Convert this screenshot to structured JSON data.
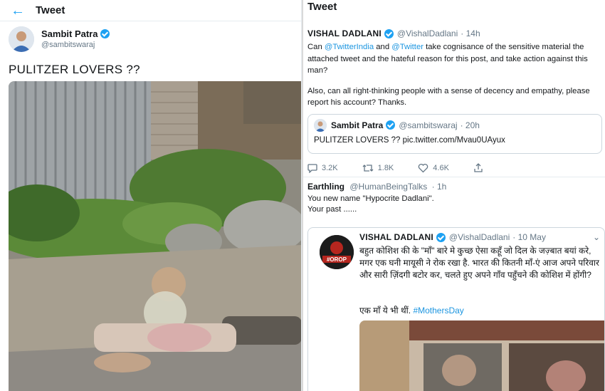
{
  "left": {
    "header": {
      "title": "Tweet"
    },
    "author": {
      "name": "Sambit Patra",
      "handle": "@sambitswaraj"
    },
    "tweet_text": "PULITZER LOVERS ??"
  },
  "right": {
    "header": {
      "title": "Tweet"
    },
    "main_tweet": {
      "name": "VISHAL DADLANI",
      "handle": "@VishalDadlani",
      "time": "· 14h",
      "body_1_pre": "Can ",
      "mention_1": "@TwitterIndia",
      "body_1_mid": " and ",
      "mention_2": "@Twitter",
      "body_1_post": " take cognisance of the sensitive material the attached tweet and the hateful reason for this post, and take action against this man?",
      "body_2": "Also, can all right-thinking people with a sense of decency and empathy, please report his account? Thanks.",
      "quoted": {
        "name": "Sambit Patra",
        "handle": "@sambitswaraj",
        "time": "· 20h",
        "text": "PULITZER LOVERS ?? pic.twitter.com/Mvau0UAyux"
      },
      "actions": {
        "replies": "3.2K",
        "retweets": "1.8K",
        "likes": "4.6K"
      }
    },
    "reply": {
      "name": "Earthling",
      "handle": "@HumanBeingTalks",
      "time": "· 1h",
      "line_1": "You new name  \"Hypocrite Dadlani\".",
      "line_2": "Your past ......",
      "quoted": {
        "avatar_text": "#OROP",
        "name": "VISHAL DADLANI",
        "handle": "@VishalDadlani",
        "time": "· 10 May",
        "text": "बहुत कोशिश की के \"माँ\" बारे मे कुच्छ ऐसा कहूँ जो दिल के जज़्बात बयां करे, मगर एक घनी मायूसी ने रोक रखा है. भारत की कितनी माँ-एं आज अपने परिवार और सारी ज़िंदगी बटोर कर, चलते हुए अपने गाँव पहुँचने की कोशिश में होंगी?",
        "line_2": "एक माँ ये भी थीं.",
        "hashtag": "#MothersDay"
      }
    }
  },
  "colors": {
    "accent": "#1da1f2",
    "link": "#1b95e0",
    "muted": "#657786",
    "border": "#e6ecf0"
  }
}
